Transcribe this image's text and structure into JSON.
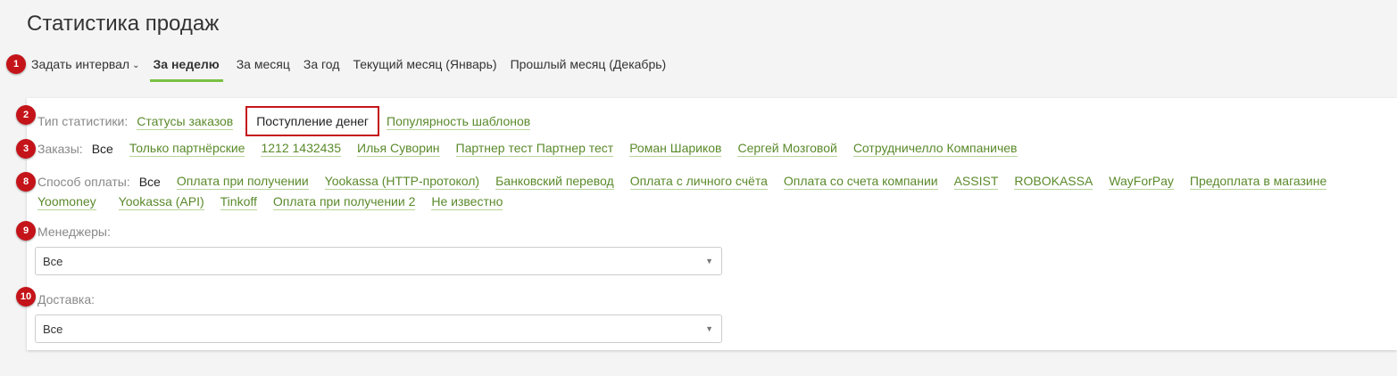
{
  "page": {
    "title": "Статистика продаж"
  },
  "badges": [
    "1",
    "2",
    "3",
    "8",
    "9",
    "10"
  ],
  "period_tabs": [
    {
      "label": "Задать интервал"
    },
    {
      "label": "За неделю"
    },
    {
      "label": "За месяц"
    },
    {
      "label": "За год"
    },
    {
      "label": "Текущий месяц (Январь)"
    },
    {
      "label": "Прошлый месяц (Декабрь)"
    }
  ],
  "stat_type": {
    "label": "Тип статистики:",
    "options": [
      "Статусы заказов",
      "Поступление денег",
      "Популярность шаблонов"
    ]
  },
  "orders": {
    "label": "Заказы:",
    "options": [
      "Все",
      "Только партнёрские",
      "1212 1432435",
      "Илья Суворин",
      "Партнер тест Партнер тест",
      "Роман Шариков",
      "Сергей Мозговой",
      "Сотрудничелло Компаничев"
    ]
  },
  "payment": {
    "label": "Способ оплаты:",
    "options": [
      "Все",
      "Оплата при получении",
      "Yookassa (HTTP-протокол)",
      "Банковский перевод",
      "Оплата с личного счёта",
      "Оплата со счета компании",
      "ASSIST",
      "ROBOKASSA",
      "WayForPay",
      "Предоплата в магазине",
      "Yoomoney",
      "Yookassa (API)",
      "Tinkoff",
      "Оплата при получении 2",
      "Не известно"
    ]
  },
  "managers": {
    "label": "Менеджеры:",
    "value": "Все"
  },
  "delivery": {
    "label": "Доставка:",
    "value": "Все"
  },
  "colors": {
    "accent": "#7ac143",
    "link": "#5a8a2b",
    "badge": "#c4141a"
  }
}
